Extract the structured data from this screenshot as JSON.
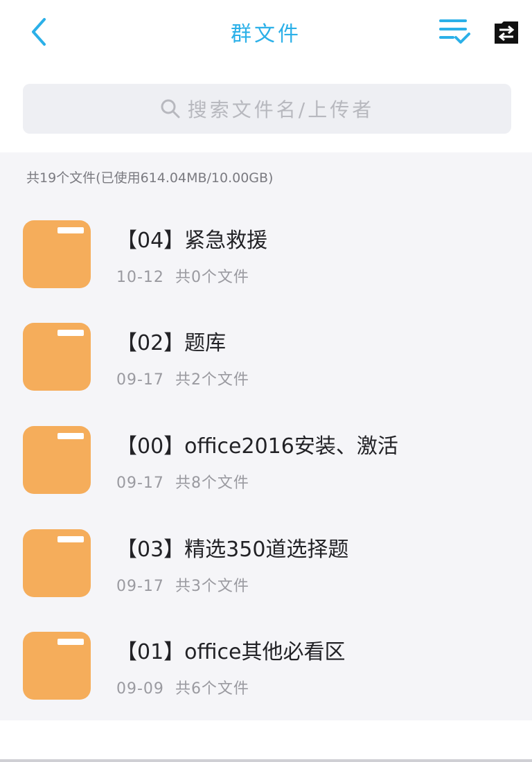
{
  "header": {
    "title": "群文件",
    "back_icon": "chevron-left-icon",
    "sort_icon": "list-check-icon",
    "transfer_icon": "transfer-folder-icon",
    "accent_color": "#2bb0e8"
  },
  "search": {
    "placeholder": "搜索文件名/上传者",
    "icon": "search-icon"
  },
  "summary": "共19个文件(已使用614.04MB/10.00GB)",
  "folder_color": "#f5ad5b",
  "items": [
    {
      "title": "【04】紧急救援",
      "date": "10-12",
      "count": "共0个文件"
    },
    {
      "title": "【02】题库",
      "date": "09-17",
      "count": "共2个文件"
    },
    {
      "title": "【00】office2016安装、激活",
      "date": "09-17",
      "count": "共8个文件"
    },
    {
      "title": "【03】精选350道选择题",
      "date": "09-17",
      "count": "共3个文件"
    },
    {
      "title": "【01】office其他必看区",
      "date": "09-09",
      "count": "共6个文件"
    }
  ]
}
